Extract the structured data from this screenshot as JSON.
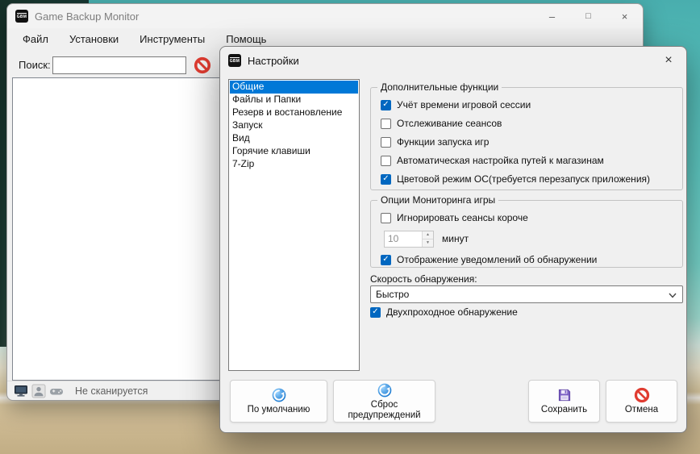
{
  "icons": {
    "app_badge": "GBM",
    "minimize_glyph": "–",
    "maximize_glyph": "□",
    "close_glyph": "×",
    "check_glyph": "✓",
    "spin_up_glyph": "▲",
    "spin_down_glyph": "▼"
  },
  "colors": {
    "selection_blue": "#0078d7",
    "checkbox_blue": "#0067c0",
    "cancel_red": "#e03c31",
    "save_purple": "#7b5fc4",
    "refresh_blue": "#1677cf"
  },
  "main_window": {
    "title": "Game Backup Monitor",
    "menu": [
      {
        "label": "Файл"
      },
      {
        "label": "Установки"
      },
      {
        "label": "Инструменты"
      },
      {
        "label": "Помощь"
      }
    ],
    "search": {
      "label": "Поиск:",
      "value": ""
    },
    "status": {
      "text": "Не сканируется"
    }
  },
  "dialog": {
    "title": "Настройки",
    "categories": [
      "Общие",
      "Файлы и Папки",
      "Резерв и востановление",
      "Запуск",
      "Вид",
      "Горячие клавиши",
      "7-Zip"
    ],
    "selected_category": "Общие",
    "additional": {
      "title": "Дополнительные функции",
      "items": [
        {
          "label": "Учёт времени игровой сессии",
          "checked": true
        },
        {
          "label": "Отслеживание сеансов",
          "checked": false
        },
        {
          "label": "Функции запуска игр",
          "checked": false
        },
        {
          "label": "Автоматическая настройка путей к магазинам",
          "checked": false
        },
        {
          "label": "Цветовой режим ОС(требуется перезапуск приложения)",
          "checked": true
        }
      ]
    },
    "monitoring": {
      "title": "Опции Мониторинга игры",
      "ignore_short": {
        "label": "Игнорировать сеансы короче",
        "checked": false
      },
      "minutes": {
        "value": "10",
        "unit": "минут"
      },
      "notifications": {
        "label": "Отображение уведомлений об обнаружении",
        "checked": true
      }
    },
    "detection": {
      "speed_label": "Скорость обнаружения:",
      "speed_value": "Быстро",
      "two_pass": {
        "label": "Двухпроходное обнаружение",
        "checked": true
      }
    },
    "buttons": {
      "defaults": "По умолчанию",
      "reset_warnings": "Сброс предупреждений",
      "save": "Сохранить",
      "cancel": "Отмена"
    }
  }
}
